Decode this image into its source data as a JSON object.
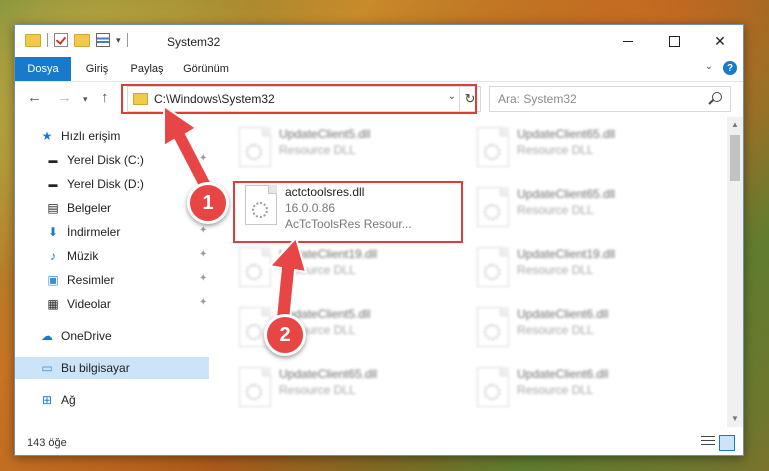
{
  "window": {
    "title": "System32"
  },
  "ribbon": {
    "tabs": [
      "Dosya",
      "Giriş",
      "Paylaş",
      "Görünüm"
    ]
  },
  "address": {
    "path": "C:\\Windows\\System32"
  },
  "search": {
    "placeholder": "Ara: System32"
  },
  "sidebar": {
    "items": [
      {
        "label": "Hızlı erişim",
        "icon": "star-icon"
      },
      {
        "label": "Yerel Disk (C:)",
        "icon": "drive-icon",
        "pinned": true
      },
      {
        "label": "Yerel Disk (D:)",
        "icon": "drive-icon"
      },
      {
        "label": "Belgeler",
        "icon": "document-icon",
        "pinned": true
      },
      {
        "label": "İndirmeler",
        "icon": "download-icon",
        "pinned": true
      },
      {
        "label": "Müzik",
        "icon": "music-icon",
        "pinned": true
      },
      {
        "label": "Resimler",
        "icon": "pictures-icon",
        "pinned": true
      },
      {
        "label": "Videolar",
        "icon": "video-icon",
        "pinned": true
      },
      {
        "label": "OneDrive",
        "icon": "cloud-icon"
      },
      {
        "label": "Bu bilgisayar",
        "icon": "computer-icon",
        "selected": true
      },
      {
        "label": "Ağ",
        "icon": "network-icon"
      }
    ]
  },
  "files": {
    "left": [
      {
        "name": "UpdateClient5.dll",
        "type": "Resource DLL"
      },
      {
        "name": "actctoolsres.dll",
        "version": "16.0.0.86",
        "description": "AcTcToolsRes Resour...",
        "highlighted": true
      },
      {
        "name": "UpdateClient19.dll",
        "type": "Resource DLL"
      },
      {
        "name": "UpdateClient5.dll",
        "type": "Resource DLL"
      },
      {
        "name": "UpdateClient65.dll",
        "type": "Resource DLL"
      }
    ],
    "right": [
      {
        "name": "UpdateClient65.dll",
        "type": "Resource DLL"
      },
      {
        "name": "UpdateClient65.dll",
        "type": "Resource DLL"
      },
      {
        "name": "UpdateClient19.dll",
        "type": "Resource DLL"
      },
      {
        "name": "UpdateClient6.dll",
        "type": "Resource DLL"
      },
      {
        "name": "UpdateClient6.dll",
        "type": "Resource DLL"
      }
    ]
  },
  "status": {
    "item_count": "143 öğe"
  },
  "callouts": [
    "1",
    "2"
  ],
  "colors": {
    "accent": "#1979ca",
    "highlight": "#e03c3c",
    "selected": "#cce4f7"
  }
}
